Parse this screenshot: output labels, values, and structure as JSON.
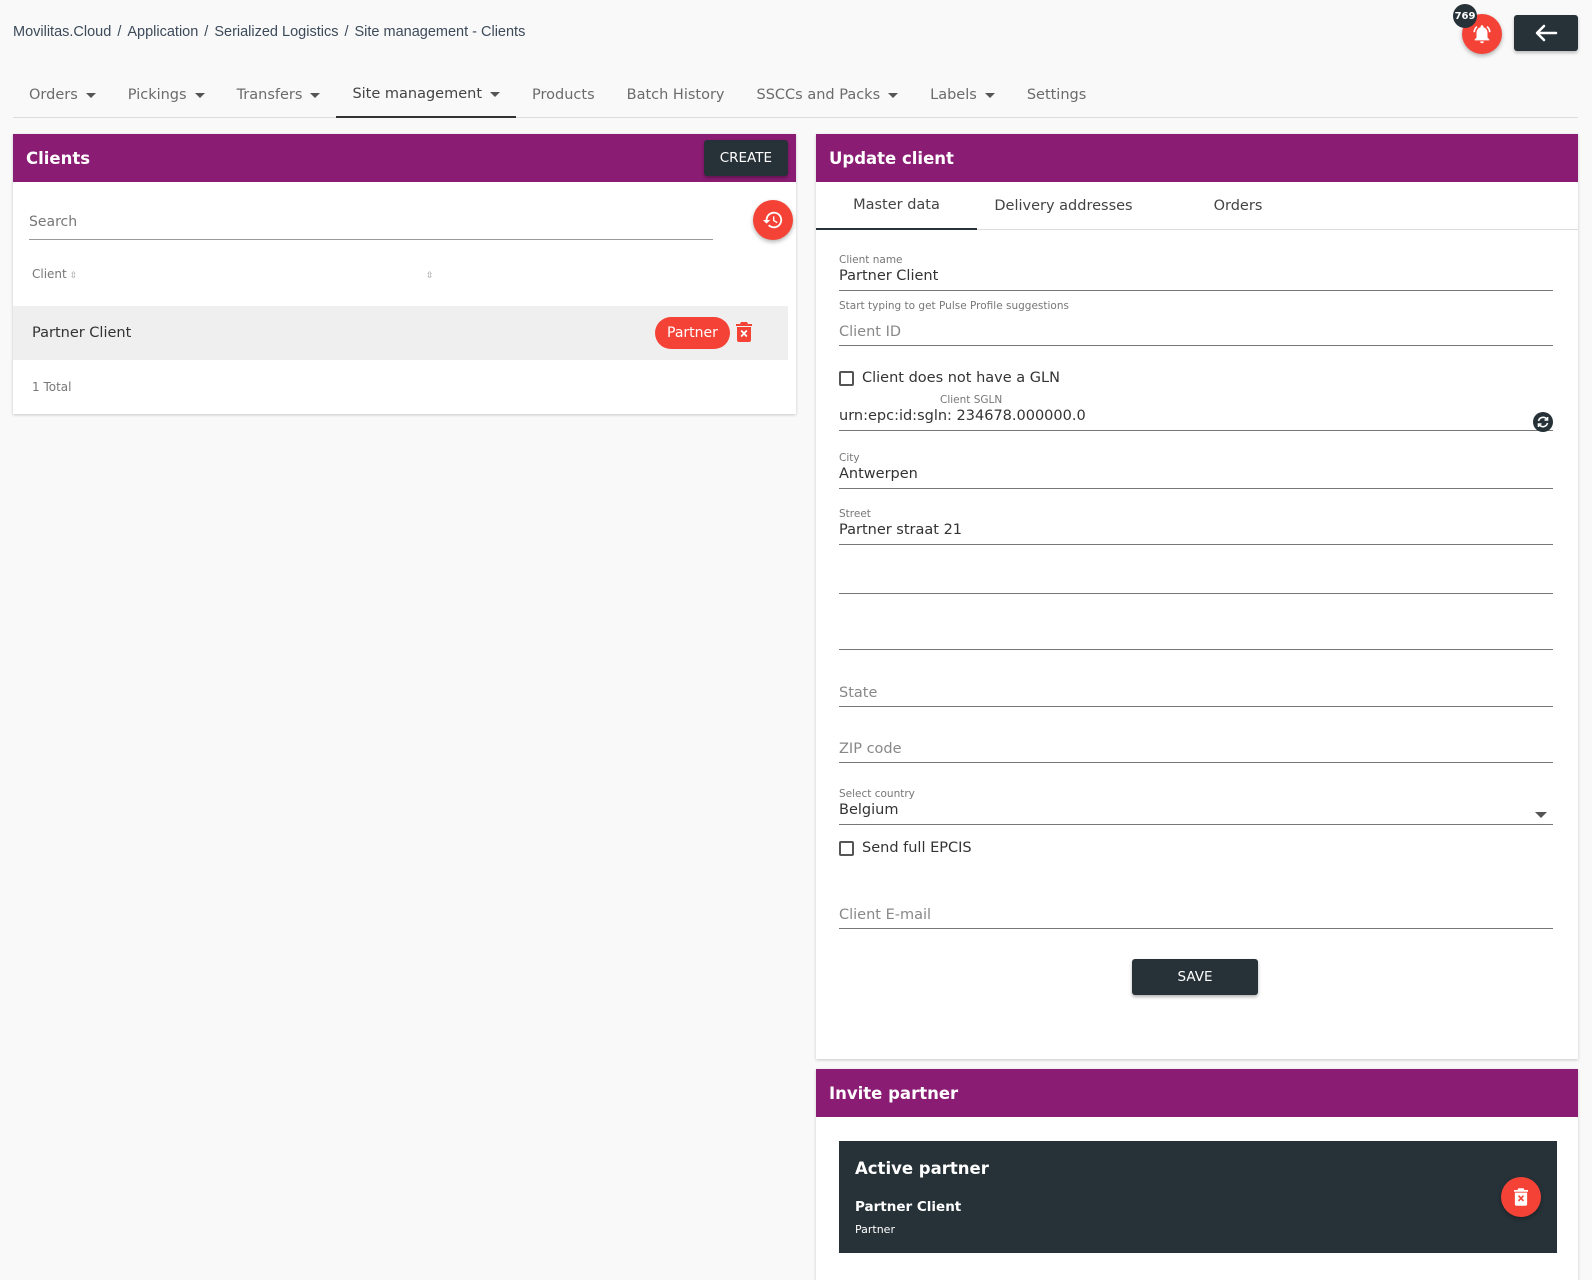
{
  "breadcrumb": [
    "Movilitas.Cloud",
    "Application",
    "Serialized Logistics",
    "Site management - Clients"
  ],
  "notifications": {
    "count": "769"
  },
  "nav_tabs": [
    {
      "label": "Orders",
      "dropdown": true
    },
    {
      "label": "Pickings",
      "dropdown": true
    },
    {
      "label": "Transfers",
      "dropdown": true
    },
    {
      "label": "Site management",
      "dropdown": true,
      "active": true
    },
    {
      "label": "Products",
      "dropdown": false
    },
    {
      "label": "Batch History",
      "dropdown": false
    },
    {
      "label": "SSCCs and Packs",
      "dropdown": true
    },
    {
      "label": "Labels",
      "dropdown": true
    },
    {
      "label": "Settings",
      "dropdown": false
    }
  ],
  "clients_panel": {
    "title": "Clients",
    "create_label": "CREATE",
    "search_placeholder": "Search",
    "column_header": "Client",
    "rows": [
      {
        "name": "Partner Client",
        "badge": "Partner"
      }
    ],
    "total": "1 Total"
  },
  "update_panel": {
    "title": "Update client",
    "tabs": [
      "Master data",
      "Delivery addresses",
      "Orders"
    ],
    "client_name_label": "Client name",
    "client_name_value": "Partner Client",
    "client_name_hint": "Start typing to get Pulse Profile suggestions",
    "client_id_placeholder": "Client ID",
    "no_gln_label": "Client does not have a GLN",
    "sgln_label": "Client SGLN",
    "sgln_value": "urn:epc:id:sgln: 234678.000000.0",
    "city_label": "City",
    "city_value": "Antwerpen",
    "street_label": "Street",
    "street_value": "Partner straat 21",
    "state_placeholder": "State",
    "zip_placeholder": "ZIP code",
    "country_label": "Select country",
    "country_value": "Belgium",
    "send_epcis_label": "Send full EPCIS",
    "email_placeholder": "Client E-mail",
    "save_label": "SAVE"
  },
  "invite_panel": {
    "title": "Invite partner",
    "active_title": "Active partner",
    "partner_name": "Partner Client",
    "partner_role": "Partner"
  },
  "colors": {
    "header_purple": "#8b1c73",
    "dark": "#263238",
    "accent_red": "#f44336"
  }
}
